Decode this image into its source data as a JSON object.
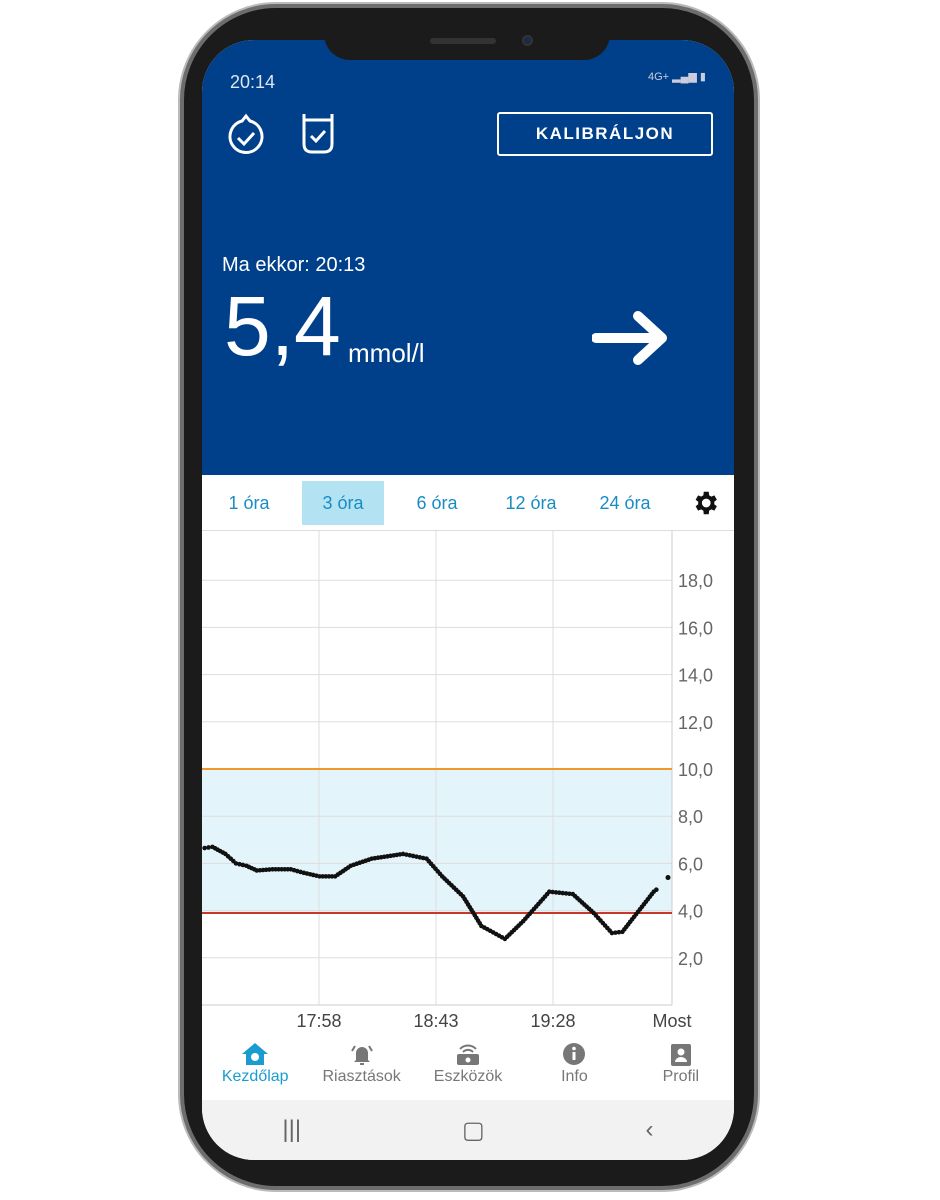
{
  "status_bar": {
    "time": "20:14",
    "network": "4G+"
  },
  "header": {
    "calibrate_label": "KALIBRÁLJON",
    "reading_time_label": "Ma ekkor: 20:13",
    "glucose_value": "5,4",
    "unit": "mmol/l",
    "trend": "steady",
    "bg_color": "#00408a"
  },
  "tabs": [
    {
      "label": "1 óra"
    },
    {
      "label": "3 óra",
      "selected": true
    },
    {
      "label": "6 óra"
    },
    {
      "label": "12 óra"
    },
    {
      "label": "24 óra"
    }
  ],
  "chart_data": {
    "type": "scatter",
    "x_ticks": [
      "17:58",
      "18:43",
      "19:28",
      "Most"
    ],
    "x_range": [
      "17:13",
      "20:13"
    ],
    "y_ticks": [
      "2,0",
      "4,0",
      "6,0",
      "8,0",
      "10,0",
      "12,0",
      "14,0",
      "16,0",
      "18,0"
    ],
    "ylim": [
      0,
      20
    ],
    "target_range": {
      "low": 3.9,
      "high": 10.0,
      "fill": "#e3f5fb",
      "high_color": "#f0962a",
      "low_color": "#c8372d"
    },
    "grid": true,
    "points": [
      [
        "17:14",
        6.65
      ],
      [
        "17:17",
        6.7
      ],
      [
        "17:22",
        6.4
      ],
      [
        "17:26",
        6.0
      ],
      [
        "17:30",
        5.9
      ],
      [
        "17:34",
        5.7
      ],
      [
        "17:40",
        5.75
      ],
      [
        "17:47",
        5.75
      ],
      [
        "17:52",
        5.6
      ],
      [
        "17:58",
        5.45
      ],
      [
        "18:04",
        5.45
      ],
      [
        "18:10",
        5.9
      ],
      [
        "18:18",
        6.2
      ],
      [
        "18:30",
        6.4
      ],
      [
        "18:39",
        6.2
      ],
      [
        "18:45",
        5.45
      ],
      [
        "18:53",
        4.6
      ],
      [
        "19:00",
        3.35
      ],
      [
        "19:09",
        2.8
      ],
      [
        "19:16",
        3.55
      ],
      [
        "19:26",
        4.8
      ],
      [
        "19:35",
        4.7
      ],
      [
        "19:43",
        3.9
      ],
      [
        "19:50",
        3.05
      ],
      [
        "19:54",
        3.1
      ],
      [
        "20:06",
        4.8
      ],
      [
        "20:13",
        5.4
      ]
    ]
  },
  "nav": [
    {
      "label": "Kezdőlap",
      "icon": "home-icon",
      "active": true
    },
    {
      "label": "Riasztások",
      "icon": "bell-icon"
    },
    {
      "label": "Eszközök",
      "icon": "device-icon"
    },
    {
      "label": "Info",
      "icon": "info-icon"
    },
    {
      "label": "Profil",
      "icon": "profile-icon"
    }
  ]
}
